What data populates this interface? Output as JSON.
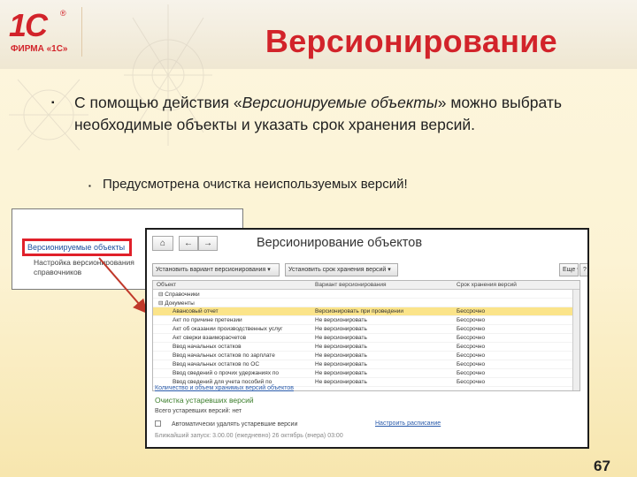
{
  "logo": {
    "mark": "1С",
    "reg": "®",
    "firm": "ФИРМА «1С»"
  },
  "slide": {
    "title": "Версионирование",
    "bullet1": {
      "before": "С помощью действия «",
      "emphasis": "Версионируемые объекты",
      "after": "» можно выбрать необходимые объекты и указать срок хранения версий."
    },
    "bullet2": "Предусмотрена очистка неиспользуемых версий!",
    "page_number": "67"
  },
  "mini_panel": {
    "link": "Версионируемые объекты",
    "line1": "Настройка версионирования",
    "line2": "справочников"
  },
  "window": {
    "title": "Версионирование объектов",
    "toolbar": {
      "set_variant": "Установить вариант версионирования ▾",
      "set_period": "Установить срок хранения версий ▾",
      "more": "Еще ▾",
      "help": "?"
    },
    "columns": [
      "Объект",
      "Вариант версионирования",
      "Срок хранения версий"
    ],
    "rows": [
      {
        "object": "⊟ Справочники",
        "variant": "",
        "period": ""
      },
      {
        "object": "⊟ Документы",
        "variant": "",
        "period": ""
      },
      {
        "object": "Авансовый отчет",
        "variant": "Версионировать при проведении",
        "period": "Бессрочно"
      },
      {
        "object": "Акт по причине претензии",
        "variant": "Не версионировать",
        "period": "Бессрочно"
      },
      {
        "object": "Акт об оказании производственных услуг",
        "variant": "Не версионировать",
        "period": "Бессрочно"
      },
      {
        "object": "Акт сверки взаиморасчетов",
        "variant": "Не версионировать",
        "period": "Бессрочно"
      },
      {
        "object": "Ввод начальных остатков",
        "variant": "Не версионировать",
        "period": "Бессрочно"
      },
      {
        "object": "Ввод начальных остатков по зарплате",
        "variant": "Не версионировать",
        "period": "Бессрочно"
      },
      {
        "object": "Ввод начальных остатков по ОС",
        "variant": "Не версионировать",
        "period": "Бессрочно"
      },
      {
        "object": "Ввод сведений о прочих удержаниях по",
        "variant": "Не версионировать",
        "period": "Бессрочно"
      },
      {
        "object": "Ввод сведений для учета пособий по",
        "variant": "Не версионировать",
        "period": "Бессрочно"
      }
    ],
    "stored_versions_link": "Количество и объем хранимых версий объектов",
    "cleanup_heading": "Очистка устаревших версий",
    "total_outdated": "Всего устаревших версий: нет",
    "auto_delete_label": "Автоматически удалять устаревшие версии",
    "configure_schedule": "Настроить расписание",
    "next_run": "Ближайший запуск: 3.00.00 (ежедневно) 26 октябрь (вчера) 03:00"
  },
  "colors": {
    "title_red": "#d2232a",
    "highlight": "#fbe48a",
    "link_blue": "#2a5bab",
    "arrow": "#c0392b"
  }
}
